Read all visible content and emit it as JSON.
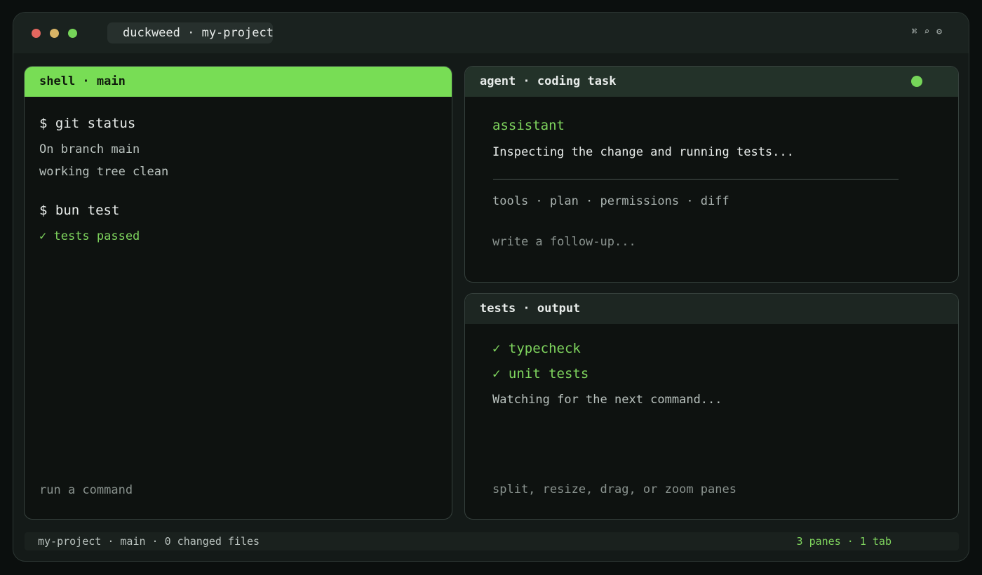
{
  "titlebar": {
    "title": "duckweed · my-project",
    "icons": [
      "command-icon",
      "search-icon",
      "gear-icon"
    ],
    "command_glyph": "⌘",
    "search_glyph": "⌕",
    "gear_glyph": "⚙",
    "traffic_lights": {
      "close": "#e4675f",
      "minimize": "#d8b466",
      "maximize": "#76d559"
    }
  },
  "shell_pane": {
    "header": "shell · main",
    "lines": [
      {
        "text": "$ git status",
        "kind": "command"
      },
      {
        "text": "On branch main",
        "kind": "output"
      },
      {
        "text": "working tree clean",
        "kind": "output"
      },
      {
        "text": "$ bun test",
        "kind": "command"
      },
      {
        "text": "✓ tests passed",
        "kind": "success"
      }
    ],
    "prompt_placeholder": "run a command"
  },
  "agent_pane": {
    "header": "agent · coding task",
    "status_color": "#76d559",
    "role": "assistant",
    "message": "Inspecting the change and running tests...",
    "tools_line": "tools · plan · permissions · diff",
    "input_placeholder": "write a follow-up..."
  },
  "tests_pane": {
    "header": "tests · output",
    "lines": [
      {
        "text": "✓ typecheck",
        "kind": "success"
      },
      {
        "text": "✓ unit tests",
        "kind": "success"
      },
      {
        "text": "Watching for the next command...",
        "kind": "output"
      }
    ],
    "hint": "split, resize, drag, or zoom panes"
  },
  "statusbar": {
    "left": "my-project · main · 0 changed files",
    "right": "3 panes · 1 tab"
  },
  "colors": {
    "accent": "#78dd55",
    "success_text": "#7fd55e",
    "output_text": "#b9c2be",
    "command_text": "#e8ecea",
    "muted_text": "#8a938f"
  }
}
